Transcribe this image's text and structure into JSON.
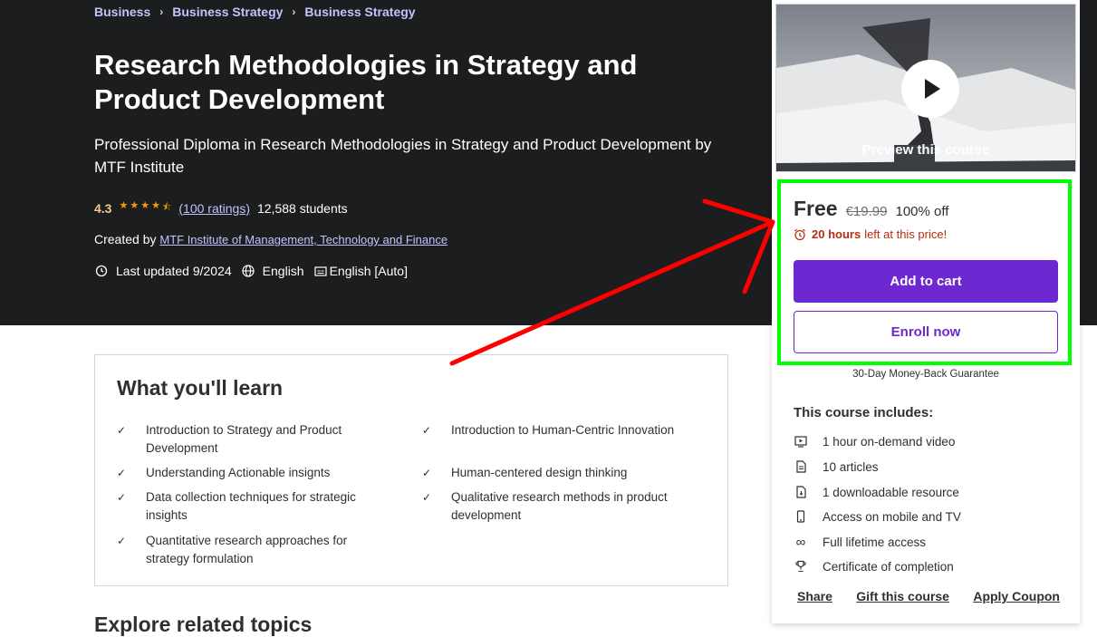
{
  "breadcrumb": [
    "Business",
    "Business Strategy",
    "Business Strategy"
  ],
  "course": {
    "title": "Research Methodologies in Strategy and Product Development",
    "subtitle": "Professional Diploma in Research Methodologies in Strategy and Product Development by MTF Institute",
    "rating": "4.3",
    "ratings_count": "(100 ratings)",
    "students": "12,588 students",
    "created_by_label": "Created by",
    "author": "MTF Institute of Management, Technology and Finance",
    "last_updated": "Last updated 9/2024",
    "language": "English",
    "captions": "English [Auto]"
  },
  "learn": {
    "title": "What you'll learn",
    "items": [
      "Introduction to Strategy and Product Development",
      "Introduction to Human-Centric Innovation",
      "Understanding Actionable insignts",
      "Human-centered design thinking",
      "Data collection techniques for strategic insights",
      "Qualitative research methods in product development",
      "Quantitative research approaches for strategy formulation"
    ]
  },
  "explore_title": "Explore related topics",
  "sidebar": {
    "preview_label": "Preview this course",
    "price": "Free",
    "original_price": "€19.99",
    "discount": "100% off",
    "timer_hours": "20 hours",
    "timer_text": "left at this price!",
    "add_to_cart": "Add to cart",
    "enroll_now": "Enroll now",
    "guarantee": "30-Day Money-Back Guarantee",
    "includes_title": "This course includes:",
    "includes": [
      {
        "icon": "video-icon",
        "label": "1 hour on-demand video"
      },
      {
        "icon": "article-icon",
        "label": "10 articles"
      },
      {
        "icon": "download-file-icon",
        "label": "1 downloadable resource"
      },
      {
        "icon": "mobile-icon",
        "label": "Access on mobile and TV"
      },
      {
        "icon": "infinity-icon",
        "label": "Full lifetime access"
      },
      {
        "icon": "trophy-icon",
        "label": "Certificate of completion"
      }
    ],
    "share": "Share",
    "gift": "Gift this course",
    "coupon": "Apply Coupon"
  },
  "colors": {
    "hero_bg": "#1c1d1f",
    "accent_purple": "#6d28d2",
    "link_lavender": "#c0c4fc",
    "star_orange": "#f69c08",
    "highlight_green": "#00ff00",
    "annotation_red": "#ff0000"
  }
}
